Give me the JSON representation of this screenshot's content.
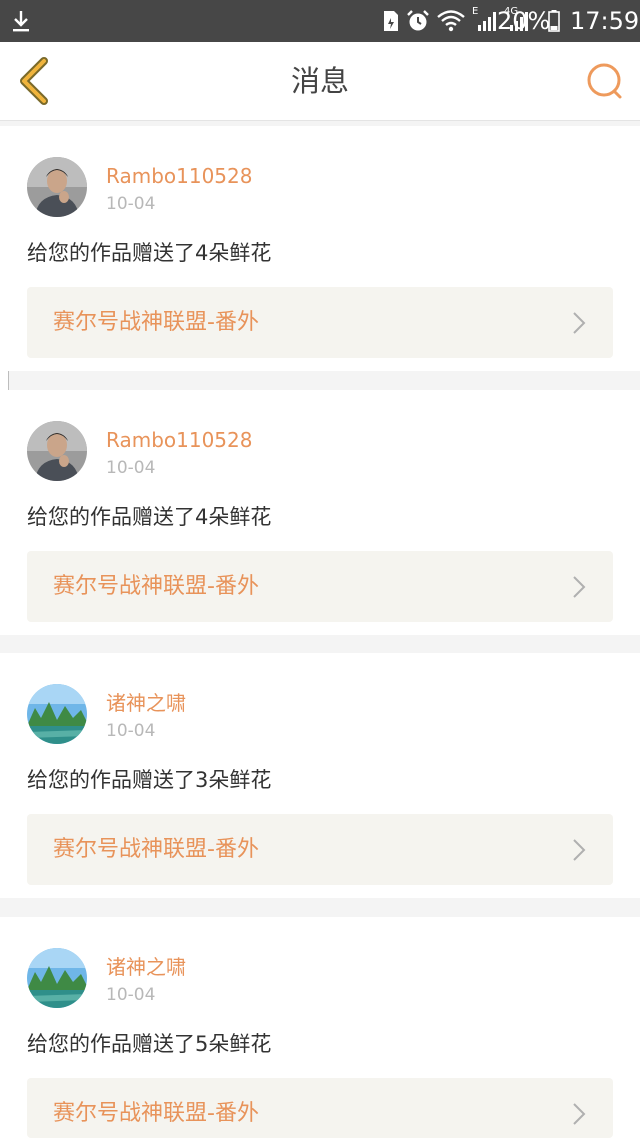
{
  "status_bar": {
    "battery_percent": "20%",
    "time": "17:59",
    "network_label": "4G",
    "signal_label": "E"
  },
  "header": {
    "title": "消息",
    "back_icon": "chevron-left-icon",
    "search_icon": "search-icon"
  },
  "colors": {
    "accent": "#e8935a",
    "back_arrow": "#f0b43c",
    "card_link_bg": "#f5f4ef",
    "separator": "#f4f4f4"
  },
  "messages": [
    {
      "username": "Rambo110528",
      "date": "10-04",
      "text": "给您的作品赠送了4朵鲜花",
      "work_title": "赛尔号战神联盟-番外",
      "avatar": "person-photo"
    },
    {
      "username": "Rambo110528",
      "date": "10-04",
      "text": "给您的作品赠送了4朵鲜花",
      "work_title": "赛尔号战神联盟-番外",
      "avatar": "person-photo"
    },
    {
      "username": "诸神之啸",
      "date": "10-04",
      "text": "给您的作品赠送了3朵鲜花",
      "work_title": "赛尔号战神联盟-番外",
      "avatar": "landscape-photo"
    },
    {
      "username": "诸神之啸",
      "date": "10-04",
      "text": "给您的作品赠送了5朵鲜花",
      "work_title": "赛尔号战神联盟-番外",
      "avatar": "landscape-photo"
    }
  ]
}
